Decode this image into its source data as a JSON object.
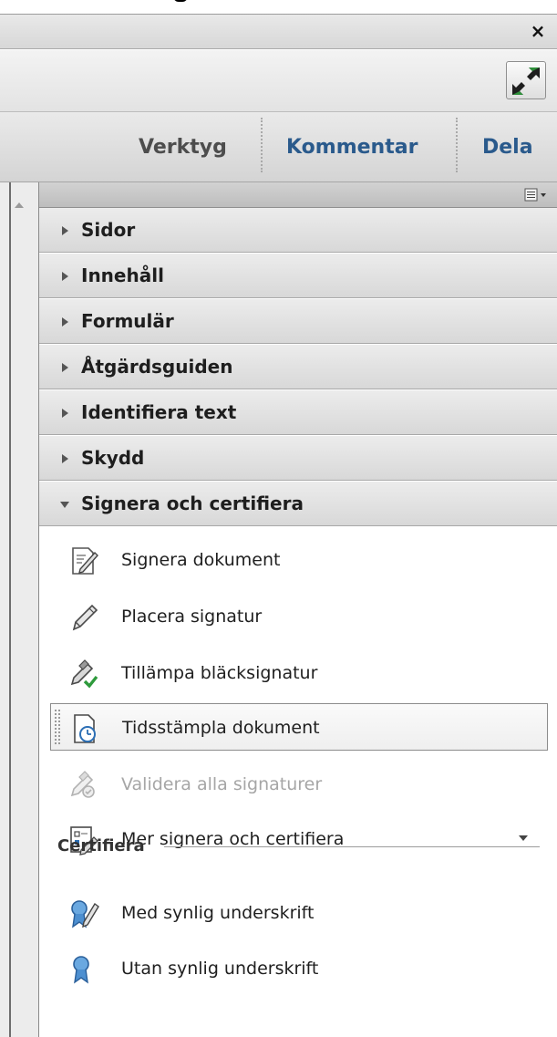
{
  "window": {
    "close_glyph": "×"
  },
  "tabs": [
    {
      "label": "Verktyg"
    },
    {
      "label": "Kommentar"
    },
    {
      "label": "Dela"
    }
  ],
  "sections": [
    {
      "label": "Sidor",
      "expanded": false
    },
    {
      "label": "Innehåll",
      "expanded": false
    },
    {
      "label": "Formulär",
      "expanded": false
    },
    {
      "label": "Åtgärdsguiden",
      "expanded": false
    },
    {
      "label": "Identifiera text",
      "expanded": false
    },
    {
      "label": "Skydd",
      "expanded": false
    },
    {
      "label": "Signera och certifiera",
      "expanded": true
    }
  ],
  "items": [
    {
      "label": "Signera dokument",
      "icon": "sign-document-icon"
    },
    {
      "label": "Placera signatur",
      "icon": "pen-icon"
    },
    {
      "label": "Tillämpa bläcksignatur",
      "icon": "ink-signature-icon"
    },
    {
      "label": "Tidsstämpla dokument",
      "icon": "timestamp-icon",
      "selected": true
    },
    {
      "label": "Validera alla signaturer",
      "icon": "validate-signatures-icon",
      "disabled": true
    },
    {
      "label": "Mer signera och certifiera",
      "icon": "more-sign-icon",
      "has_dropdown": true
    }
  ],
  "certify": {
    "title": "Certifiera",
    "items": [
      {
        "label": "Med synlig underskrift",
        "icon": "ribbon-pen-icon"
      },
      {
        "label": "Utan synlig underskrift",
        "icon": "ribbon-icon"
      }
    ]
  },
  "colors": {
    "link_tab": "#2a5a8c",
    "active_tab": "#4d4d4d",
    "disabled_text": "#a6a6a6"
  }
}
